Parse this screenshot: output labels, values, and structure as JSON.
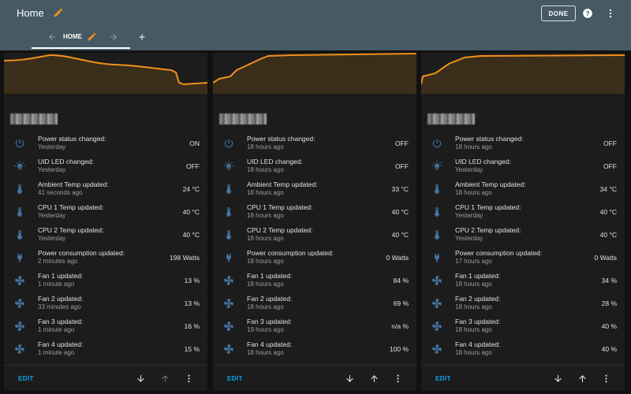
{
  "header": {
    "title": "Home",
    "done_label": "DONE",
    "background": "#455a64"
  },
  "tabs": [
    {
      "label": "HOME"
    }
  ],
  "accent": "#f0901c",
  "footer": {
    "edit_label": "EDIT"
  },
  "cards": [
    {
      "title_blurred": "redacted",
      "rows": [
        {
          "icon": "power-icon",
          "name": "Power status changed:",
          "time": "Yesterday",
          "value": "ON"
        },
        {
          "icon": "led-icon",
          "name": "UID LED changed:",
          "time": "Yesterday",
          "value": "OFF"
        },
        {
          "icon": "thermometer-icon",
          "name": "Ambient Temp updated:",
          "time": "41 seconds ago",
          "value": "24 °C"
        },
        {
          "icon": "thermometer-icon",
          "name": "CPU 1 Temp updated:",
          "time": "Yesterday",
          "value": "40 °C"
        },
        {
          "icon": "thermometer-icon",
          "name": "CPU 2 Temp updated:",
          "time": "Yesterday",
          "value": "40 °C"
        },
        {
          "icon": "plug-icon",
          "name": "Power consumption updated:",
          "time": "2 minutes ago",
          "value": "198 Watts"
        },
        {
          "icon": "fan-icon",
          "name": "Fan 1 updated:",
          "time": "1 minute ago",
          "value": "13 %"
        },
        {
          "icon": "fan-icon",
          "name": "Fan 2 updated:",
          "time": "33 minutes ago",
          "value": "13 %"
        },
        {
          "icon": "fan-icon",
          "name": "Fan 3 updated:",
          "time": "1 minute ago",
          "value": "16 %"
        },
        {
          "icon": "fan-icon",
          "name": "Fan 4 updated:",
          "time": "1 minute ago",
          "value": "15 %"
        }
      ]
    },
    {
      "title_blurred": "redacted",
      "rows": [
        {
          "icon": "power-icon",
          "name": "Power status changed:",
          "time": "18 hours ago",
          "value": "OFF"
        },
        {
          "icon": "led-icon",
          "name": "UID LED changed:",
          "time": "18 hours ago",
          "value": "OFF"
        },
        {
          "icon": "thermometer-icon",
          "name": "Ambient Temp updated:",
          "time": "18 hours ago",
          "value": "33 °C"
        },
        {
          "icon": "thermometer-icon",
          "name": "CPU 1 Temp updated:",
          "time": "18 hours ago",
          "value": "40 °C"
        },
        {
          "icon": "thermometer-icon",
          "name": "CPU 2 Temp updated:",
          "time": "18 hours ago",
          "value": "40 °C"
        },
        {
          "icon": "plug-icon",
          "name": "Power consumption updated:",
          "time": "18 hours ago",
          "value": "0 Watts"
        },
        {
          "icon": "fan-icon",
          "name": "Fan 1 updated:",
          "time": "18 hours ago",
          "value": "84 %"
        },
        {
          "icon": "fan-icon",
          "name": "Fan 2 updated:",
          "time": "18 hours ago",
          "value": "69 %"
        },
        {
          "icon": "fan-icon",
          "name": "Fan 3 updated:",
          "time": "19 hours ago",
          "value": "n/a %"
        },
        {
          "icon": "fan-icon",
          "name": "Fan 4 updated:",
          "time": "18 hours ago",
          "value": "100 %"
        }
      ]
    },
    {
      "title_blurred": "redacted",
      "rows": [
        {
          "icon": "power-icon",
          "name": "Power status changed:",
          "time": "18 hours ago",
          "value": "OFF"
        },
        {
          "icon": "led-icon",
          "name": "UID LED changed:",
          "time": "Yesterday",
          "value": "OFF"
        },
        {
          "icon": "thermometer-icon",
          "name": "Ambient Temp updated:",
          "time": "18 hours ago",
          "value": "34 °C"
        },
        {
          "icon": "thermometer-icon",
          "name": "CPU 1 Temp updated:",
          "time": "Yesterday",
          "value": "40 °C"
        },
        {
          "icon": "thermometer-icon",
          "name": "CPU 2 Temp updated:",
          "time": "Yesterday",
          "value": "40 °C"
        },
        {
          "icon": "plug-icon",
          "name": "Power consumption updated:",
          "time": "17 hours ago",
          "value": "0 Watts"
        },
        {
          "icon": "fan-icon",
          "name": "Fan 1 updated:",
          "time": "18 hours ago",
          "value": "34 %"
        },
        {
          "icon": "fan-icon",
          "name": "Fan 2 updated:",
          "time": "18 hours ago",
          "value": "28 %"
        },
        {
          "icon": "fan-icon",
          "name": "Fan 3 updated:",
          "time": "18 hours ago",
          "value": "40 %"
        },
        {
          "icon": "fan-icon",
          "name": "Fan 4 updated:",
          "time": "18 hours ago",
          "value": "40 %"
        }
      ]
    }
  ]
}
